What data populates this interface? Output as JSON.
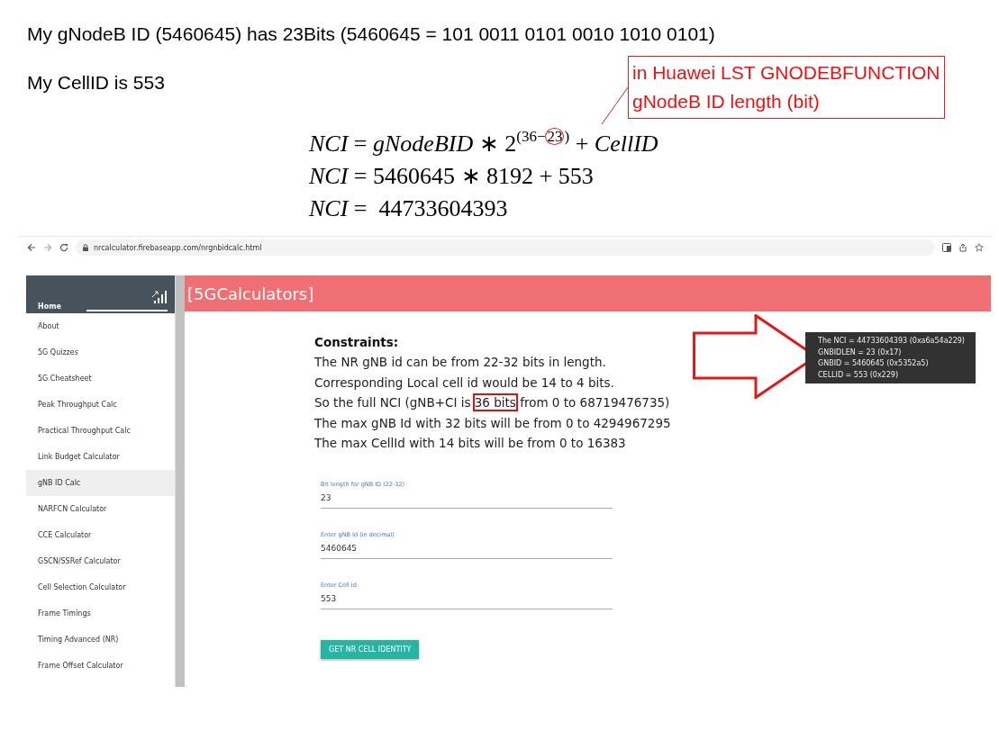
{
  "notes": {
    "lines": [
      "My gNodeB ID (5460645) has 23Bits (5460645 = 101 0011 0101 0010 1010 0101)",
      "My CellID is 553"
    ]
  },
  "callout": {
    "lines": [
      "in Huawei LST GNODEBFUNCTION",
      "gNodeB ID length (bit)"
    ]
  },
  "equations": [
    {
      "kind": "exponent",
      "base": "*NCI* = *gNodeBID* ∗ 2",
      "exponent_prefix": "(36−",
      "exponent_circled": "23",
      "exponent_suffix": ")",
      "rest": " + *CellID*"
    },
    {
      "kind": "plain",
      "text": "*NCI* = 5460645 ∗ 8192 + 553"
    },
    {
      "kind": "plain",
      "text": "*NCI* =  44733604393"
    }
  ],
  "browser": {
    "url": "nrcalculator.firebaseapp.com/nrgnbidcalc.html"
  },
  "sidebar": {
    "home": "Home",
    "items": [
      {
        "label": "About",
        "selected": false
      },
      {
        "label": "5G Quizzes",
        "selected": false
      },
      {
        "label": "5G Cheatsheet",
        "selected": false
      },
      {
        "label": "Peak Throughput Calc",
        "selected": false
      },
      {
        "label": "Practical Throughput Calc",
        "selected": false
      },
      {
        "label": "Link Budget Calculator",
        "selected": false
      },
      {
        "label": "gNB ID Calc",
        "selected": true
      },
      {
        "label": "NARFCN Calculator",
        "selected": false
      },
      {
        "label": "CCE Calculator",
        "selected": false
      },
      {
        "label": "GSCN/SSRef Calculator",
        "selected": false
      },
      {
        "label": "Cell Selection Calculator",
        "selected": false
      },
      {
        "label": "Frame Timings",
        "selected": false
      },
      {
        "label": "Timing Advanced (NR)",
        "selected": false
      },
      {
        "label": "Frame Offset Calculator",
        "selected": false
      }
    ]
  },
  "header": {
    "title": "[5GCalculators]"
  },
  "constraints": {
    "title": "Constraints:",
    "lines": [
      {
        "kind": "plain",
        "text": "The NR gNB id can be from 22-32 bits in length."
      },
      {
        "kind": "plain",
        "text": "Corresponding Local cell id would be 14 to 4 bits."
      },
      {
        "kind": "boxed",
        "before": "So the full NCI (gNB+CI is ",
        "boxed": "36 bits",
        "after": " from 0 to 68719476735)"
      },
      {
        "kind": "plain",
        "text": "The max gNB Id with 32 bits will be from 0 to 4294967295"
      },
      {
        "kind": "plain",
        "text": "The max CellId with 14 bits will be from 0 to 16383"
      }
    ]
  },
  "fields": [
    {
      "label": "Bit length for gNB ID (22-32)",
      "value": "23"
    },
    {
      "label": "Enter gNB Id (in decimal)",
      "value": "5460645"
    },
    {
      "label": "Enter Cell Id",
      "value": "553"
    }
  ],
  "button": {
    "label": "GET NR CELL IDENTITY"
  },
  "result": {
    "lines": [
      "The NCI = 44733604393 (0xa6a54a229)",
      "GNBIDLEN = 23 (0x17)",
      "GNBID = 5460645 (0x5352a5)",
      "CELLID = 553 (0x229)"
    ]
  }
}
